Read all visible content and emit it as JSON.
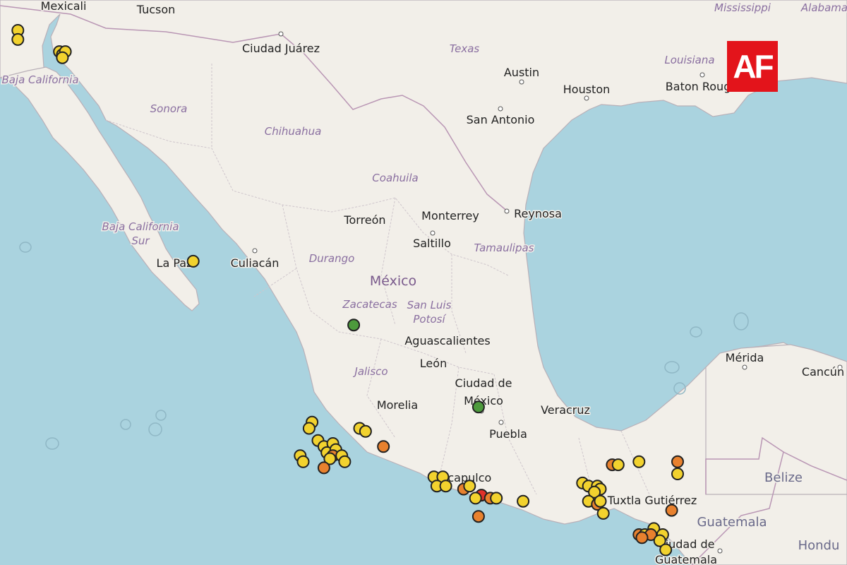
{
  "map": {
    "countries": [
      {
        "id": "mexico",
        "label": "México"
      },
      {
        "id": "guatemala",
        "label": "Guatemala"
      },
      {
        "id": "belize",
        "label": "Belize"
      },
      {
        "id": "honduras",
        "label": "Hondu"
      }
    ],
    "states": [
      {
        "id": "sonora",
        "label": "Sonora"
      },
      {
        "id": "chihuahua",
        "label": "Chihuahua"
      },
      {
        "id": "coahuila",
        "label": "Coahuila"
      },
      {
        "id": "durango",
        "label": "Durango"
      },
      {
        "id": "zacatecas",
        "label": "Zacatecas"
      },
      {
        "id": "sanluis1",
        "label": "San Luis"
      },
      {
        "id": "sanluis2",
        "label": "Potosí"
      },
      {
        "id": "tamaulipas",
        "label": "Tamaulipas"
      },
      {
        "id": "jalisco",
        "label": "Jalisco"
      },
      {
        "id": "bajacal",
        "label": "Baja California"
      },
      {
        "id": "bajasur1",
        "label": "Baja California"
      },
      {
        "id": "bajasur2",
        "label": "Sur"
      },
      {
        "id": "texas",
        "label": "Texas"
      },
      {
        "id": "louisiana",
        "label": "Louisiana"
      },
      {
        "id": "mississippi",
        "label": "Mississippi"
      },
      {
        "id": "alabama",
        "label": "Alabama"
      }
    ],
    "cities": [
      {
        "id": "mexicali",
        "label": "Mexicali"
      },
      {
        "id": "tucson",
        "label": "Tucson"
      },
      {
        "id": "juarez",
        "label": "Ciudad Juárez"
      },
      {
        "id": "austin",
        "label": "Austin"
      },
      {
        "id": "houston",
        "label": "Houston"
      },
      {
        "id": "batonrouge",
        "label": "Baton Rouge"
      },
      {
        "id": "sanantonio",
        "label": "San Antonio"
      },
      {
        "id": "torreon",
        "label": "Torreón"
      },
      {
        "id": "monterrey",
        "label": "Monterrey"
      },
      {
        "id": "reynosa",
        "label": "Reynosa"
      },
      {
        "id": "saltillo",
        "label": "Saltillo"
      },
      {
        "id": "lapaz",
        "label": "La Paz"
      },
      {
        "id": "culiacan",
        "label": "Culiacán"
      },
      {
        "id": "aguascalientes",
        "label": "Aguascalientes"
      },
      {
        "id": "leon",
        "label": "León"
      },
      {
        "id": "cdmx1",
        "label": "Ciudad de"
      },
      {
        "id": "cdmx2",
        "label": "México"
      },
      {
        "id": "morelia",
        "label": "Morelia"
      },
      {
        "id": "veracruz",
        "label": "Veracruz"
      },
      {
        "id": "puebla",
        "label": "Puebla"
      },
      {
        "id": "acapulco",
        "label": "Acapulco"
      },
      {
        "id": "tuxtla",
        "label": "Tuxtla Gutiérrez"
      },
      {
        "id": "merida",
        "label": "Mérida"
      },
      {
        "id": "cancun",
        "label": "Cancún"
      },
      {
        "id": "guate1",
        "label": "Ciudad de"
      },
      {
        "id": "guate2",
        "label": "Guatemala"
      }
    ],
    "legend_colors": {
      "minor": "#f2d22e",
      "light": "#f0a531",
      "moderate": "#e8812e",
      "strong": "#e0312a",
      "other": "#4d9a3c"
    },
    "markers": [
      {
        "lon": -114.5,
        "lat": 32.0,
        "level": "minor"
      },
      {
        "lon": -114.5,
        "lat": 31.7,
        "level": "minor"
      },
      {
        "lon": -113.1,
        "lat": 31.3,
        "level": "minor"
      },
      {
        "lon": -113.0,
        "lat": 31.2,
        "level": "minor"
      },
      {
        "lon": -112.9,
        "lat": 31.3,
        "level": "minor"
      },
      {
        "lon": -113.0,
        "lat": 31.1,
        "level": "minor"
      },
      {
        "lon": -108.6,
        "lat": 24.4,
        "level": "minor"
      },
      {
        "lon": -103.2,
        "lat": 22.3,
        "level": "other"
      },
      {
        "lon": -99.0,
        "lat": 19.6,
        "level": "other"
      },
      {
        "lon": -104.6,
        "lat": 19.1,
        "level": "minor"
      },
      {
        "lon": -104.7,
        "lat": 18.9,
        "level": "minor"
      },
      {
        "lon": -103.0,
        "lat": 18.9,
        "level": "minor"
      },
      {
        "lon": -102.8,
        "lat": 18.8,
        "level": "minor"
      },
      {
        "lon": -104.4,
        "lat": 18.5,
        "level": "minor"
      },
      {
        "lon": -104.2,
        "lat": 18.3,
        "level": "minor"
      },
      {
        "lon": -103.9,
        "lat": 18.4,
        "level": "minor"
      },
      {
        "lon": -104.1,
        "lat": 18.1,
        "level": "minor"
      },
      {
        "lon": -103.8,
        "lat": 18.2,
        "level": "minor"
      },
      {
        "lon": -103.9,
        "lat": 18.0,
        "level": "moderate"
      },
      {
        "lon": -104.0,
        "lat": 17.9,
        "level": "minor"
      },
      {
        "lon": -103.6,
        "lat": 18.0,
        "level": "minor"
      },
      {
        "lon": -105.0,
        "lat": 18.0,
        "level": "minor"
      },
      {
        "lon": -104.9,
        "lat": 17.8,
        "level": "minor"
      },
      {
        "lon": -103.5,
        "lat": 17.8,
        "level": "minor"
      },
      {
        "lon": -104.2,
        "lat": 17.6,
        "level": "moderate"
      },
      {
        "lon": -102.2,
        "lat": 18.3,
        "level": "moderate"
      },
      {
        "lon": -100.5,
        "lat": 17.3,
        "level": "minor"
      },
      {
        "lon": -100.2,
        "lat": 17.3,
        "level": "minor"
      },
      {
        "lon": -100.4,
        "lat": 17.0,
        "level": "minor"
      },
      {
        "lon": -100.1,
        "lat": 17.0,
        "level": "minor"
      },
      {
        "lon": -99.5,
        "lat": 16.9,
        "level": "moderate"
      },
      {
        "lon": -99.3,
        "lat": 17.0,
        "level": "minor"
      },
      {
        "lon": -98.9,
        "lat": 16.7,
        "level": "strong"
      },
      {
        "lon": -99.1,
        "lat": 16.6,
        "level": "minor"
      },
      {
        "lon": -98.6,
        "lat": 16.6,
        "level": "moderate"
      },
      {
        "lon": -98.4,
        "lat": 16.6,
        "level": "minor"
      },
      {
        "lon": -97.5,
        "lat": 16.5,
        "level": "minor"
      },
      {
        "lon": -99.0,
        "lat": 16.0,
        "level": "moderate"
      },
      {
        "lon": -95.5,
        "lat": 17.1,
        "level": "minor"
      },
      {
        "lon": -95.3,
        "lat": 17.0,
        "level": "minor"
      },
      {
        "lon": -95.0,
        "lat": 17.0,
        "level": "minor"
      },
      {
        "lon": -94.9,
        "lat": 16.9,
        "level": "minor"
      },
      {
        "lon": -95.1,
        "lat": 16.8,
        "level": "minor"
      },
      {
        "lon": -95.3,
        "lat": 16.5,
        "level": "minor"
      },
      {
        "lon": -95.0,
        "lat": 16.4,
        "level": "moderate"
      },
      {
        "lon": -94.9,
        "lat": 16.5,
        "level": "minor"
      },
      {
        "lon": -94.8,
        "lat": 16.1,
        "level": "minor"
      },
      {
        "lon": -94.5,
        "lat": 17.7,
        "level": "moderate"
      },
      {
        "lon": -94.3,
        "lat": 17.7,
        "level": "minor"
      },
      {
        "lon": -93.6,
        "lat": 17.8,
        "level": "minor"
      },
      {
        "lon": -92.3,
        "lat": 17.8,
        "level": "moderate"
      },
      {
        "lon": -92.3,
        "lat": 17.4,
        "level": "minor"
      },
      {
        "lon": -92.5,
        "lat": 16.2,
        "level": "moderate"
      },
      {
        "lon": -93.1,
        "lat": 15.6,
        "level": "minor"
      },
      {
        "lon": -93.6,
        "lat": 15.4,
        "level": "moderate"
      },
      {
        "lon": -93.4,
        "lat": 15.4,
        "level": "minor"
      },
      {
        "lon": -93.2,
        "lat": 15.4,
        "level": "moderate"
      },
      {
        "lon": -92.8,
        "lat": 15.4,
        "level": "minor"
      },
      {
        "lon": -92.9,
        "lat": 15.2,
        "level": "minor"
      },
      {
        "lon": -93.5,
        "lat": 15.3,
        "level": "moderate"
      },
      {
        "lon": -92.7,
        "lat": 14.9,
        "level": "minor"
      }
    ]
  },
  "logo": {
    "text": "AF"
  }
}
